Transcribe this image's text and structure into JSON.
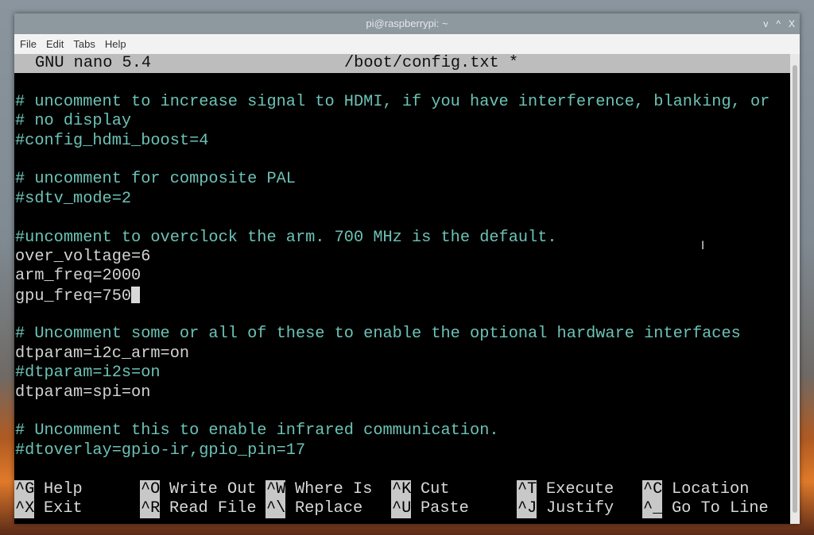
{
  "window": {
    "title": "pi@raspberrypi: ~",
    "controls": [
      "v",
      "^",
      "X"
    ]
  },
  "menu": [
    "File",
    "Edit",
    "Tabs",
    "Help"
  ],
  "nano": {
    "version": "GNU nano 5.4",
    "filename": "/boot/config.txt *"
  },
  "lines": [
    {
      "text": "",
      "comment": false
    },
    {
      "text": "# uncomment to increase signal to HDMI, if you have interference, blanking, or",
      "comment": true
    },
    {
      "text": "# no display",
      "comment": true
    },
    {
      "text": "#config_hdmi_boost=4",
      "comment": true
    },
    {
      "text": "",
      "comment": false
    },
    {
      "text": "# uncomment for composite PAL",
      "comment": true
    },
    {
      "text": "#sdtv_mode=2",
      "comment": true
    },
    {
      "text": "",
      "comment": false
    },
    {
      "text": "#uncomment to overclock the arm. 700 MHz is the default.",
      "comment": true
    },
    {
      "text": "over_voltage=6",
      "comment": false
    },
    {
      "text": "arm_freq=2000",
      "comment": false
    },
    {
      "text": "gpu_freq=750",
      "comment": false,
      "cursor": true
    },
    {
      "text": "",
      "comment": false
    },
    {
      "text": "# Uncomment some or all of these to enable the optional hardware interfaces",
      "comment": true
    },
    {
      "text": "dtparam=i2c_arm=on",
      "comment": false
    },
    {
      "text": "#dtparam=i2s=on",
      "comment": true
    },
    {
      "text": "dtparam=spi=on",
      "comment": false
    },
    {
      "text": "",
      "comment": false
    },
    {
      "text": "# Uncomment this to enable infrared communication.",
      "comment": true
    },
    {
      "text": "#dtoverlay=gpio-ir,gpio_pin=17",
      "comment": true
    },
    {
      "text": "",
      "comment": false
    }
  ],
  "shortcuts": [
    [
      {
        "key": "^G",
        "label": "Help"
      },
      {
        "key": "^O",
        "label": "Write Out"
      },
      {
        "key": "^W",
        "label": "Where Is"
      },
      {
        "key": "^K",
        "label": "Cut"
      },
      {
        "key": "^T",
        "label": "Execute"
      },
      {
        "key": "^C",
        "label": "Location"
      }
    ],
    [
      {
        "key": "^X",
        "label": "Exit"
      },
      {
        "key": "^R",
        "label": "Read File"
      },
      {
        "key": "^\\",
        "label": "Replace"
      },
      {
        "key": "^U",
        "label": "Paste"
      },
      {
        "key": "^J",
        "label": "Justify"
      },
      {
        "key": "^_",
        "label": "Go To Line"
      }
    ]
  ],
  "colors": {
    "comment": "#6cc2b6",
    "text": "#d2d2d2",
    "header_bg": "#bdbdbd"
  }
}
